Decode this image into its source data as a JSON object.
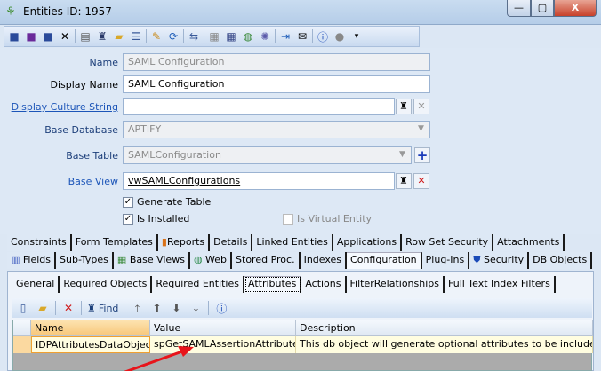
{
  "window": {
    "title": "Entities ID: 1957",
    "minimize": "—",
    "maximize": "▢",
    "close": "X"
  },
  "form": {
    "name_label": "Name",
    "name_value": "SAML Configuration",
    "display_name_label": "Display Name",
    "display_name_value": "SAML Configuration",
    "display_culture_label": "Display Culture String",
    "display_culture_value": "",
    "base_database_label": "Base Database",
    "base_database_value": "APTIFY",
    "base_table_label": "Base Table",
    "base_table_value": "SAMLConfiguration",
    "base_view_label": "Base View",
    "base_view_value": "vwSAMLConfigurations",
    "generate_table_label": "Generate Table",
    "is_installed_label": "Is Installed",
    "is_virtual_label": "Is Virtual Entity"
  },
  "tabs_row1": [
    "Constraints",
    "Form Templates",
    "Reports",
    "Details",
    "Linked Entities",
    "Applications",
    "Row Set Security",
    "Attachments"
  ],
  "tabs_row2": [
    "Fields",
    "Sub-Types",
    "Base Views",
    "Web",
    "Stored Proc.",
    "Indexes",
    "Configuration",
    "Plug-Ins",
    "Security",
    "DB Objects"
  ],
  "subtabs": [
    "General",
    "Required Objects",
    "Required Entities",
    "Attributes",
    "Actions",
    "FilterRelationships",
    "Full Text Index Filters"
  ],
  "grid_toolbar": {
    "find_label": "Find"
  },
  "grid": {
    "columns": [
      "Name",
      "Value",
      "Description"
    ],
    "rows": [
      [
        "IDPAttributesDataObject",
        "spGetSAMLAssertionAttributes",
        "This db object will generate optional attributes to be included in th"
      ]
    ]
  },
  "colors": {
    "accent": "#1c55b8",
    "arrow": "#e8141a"
  }
}
